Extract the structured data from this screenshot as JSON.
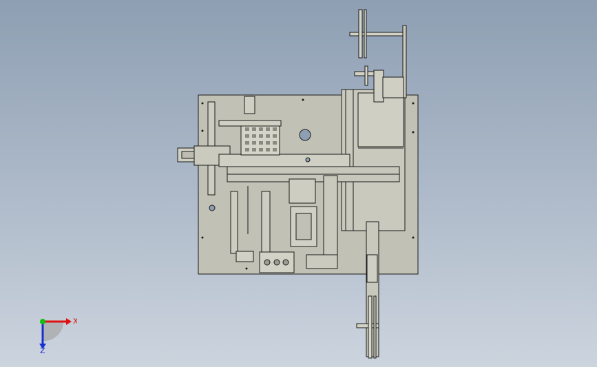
{
  "viewport": {
    "background_top": "#8e9fb3",
    "background_bottom": "#ccd4de",
    "model_face_color": "#c3c3b7",
    "edge_color": "#1a1a1a"
  },
  "triad": {
    "x_label": "X",
    "z_label": "Z",
    "x_color": "#e01010",
    "y_color": "#10c010",
    "z_color": "#1a2fd0"
  },
  "icons": [
    "coordinate-triad-icon"
  ]
}
